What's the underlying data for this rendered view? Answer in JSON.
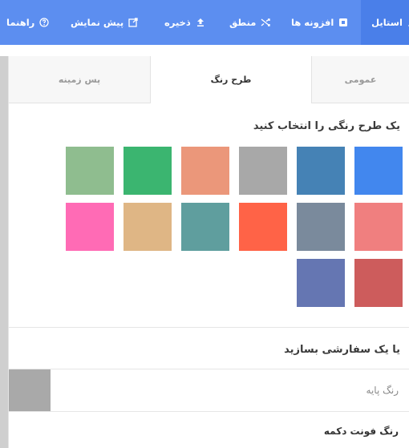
{
  "toolbar": {
    "items": [
      {
        "label": "استایل",
        "icon": "brush-icon"
      },
      {
        "label": "افزونه ها",
        "icon": "plugin-icon"
      },
      {
        "label": "منطق",
        "icon": "shuffle-icon"
      },
      {
        "label": "ذخیره",
        "icon": "upload-icon"
      },
      {
        "label": "پیش نمایش",
        "icon": "external-link-icon"
      },
      {
        "label": "راهنما",
        "icon": "help-icon"
      }
    ]
  },
  "tabs": [
    {
      "label": "عمومی"
    },
    {
      "label": "طرح رنگ"
    },
    {
      "label": "پس زمینه"
    }
  ],
  "scheme": {
    "title": "یک طرح رنگی را انتخاب کنید",
    "swatches": [
      "#4287ee",
      "#4582b5",
      "#a8a8a8",
      "#eb977a",
      "#3bb570",
      "#8fbd8f",
      "#f07f7f",
      "#7a8a9c",
      "#ff6347",
      "#5f9e9e",
      "#dfb685",
      "#ff6bb5",
      "#cd5c5c",
      "#6576b2"
    ]
  },
  "custom": {
    "title": "یا یک سفارشی بسازید",
    "base_label": "رنگ پایه",
    "base_color": "#a9a9a9",
    "button_font_label": "رنگ فونت دکمه"
  }
}
